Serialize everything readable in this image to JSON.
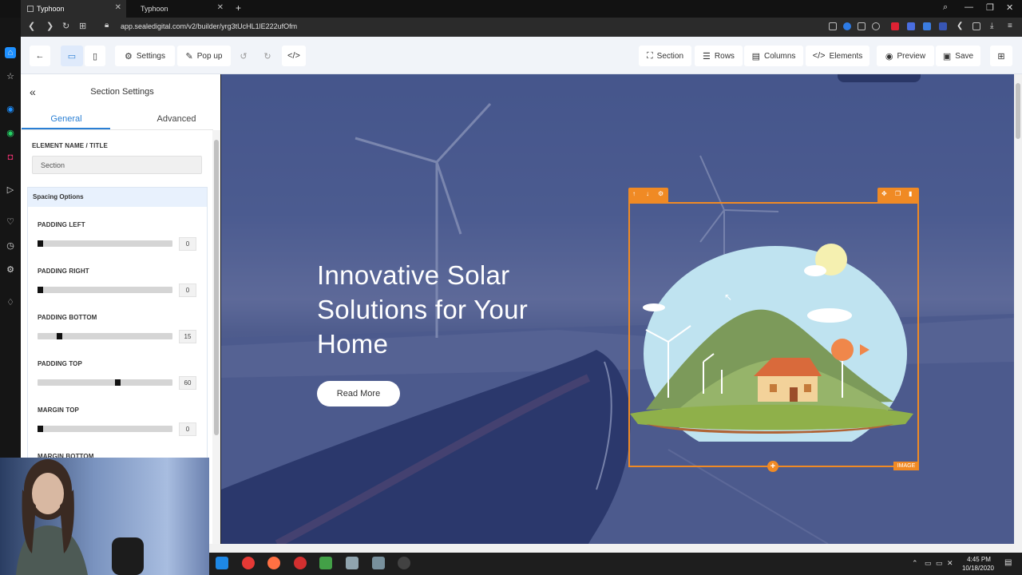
{
  "browser": {
    "tabs": [
      {
        "title": "Typhoon",
        "active": true
      },
      {
        "title": "Typhoon",
        "active": false
      }
    ],
    "new_tab": "+",
    "url": "app.sealedigital.com/v2/builder/yrg3tUcHL1lE222ufOfm"
  },
  "toolbar": {
    "settings": "Settings",
    "popup": "Pop up",
    "section": "Section",
    "rows": "Rows",
    "columns": "Columns",
    "elements": "Elements",
    "preview": "Preview",
    "save": "Save"
  },
  "panel": {
    "title": "Section Settings",
    "tabs": [
      "General",
      "Advanced"
    ],
    "element_name_label": "ELEMENT NAME / TITLE",
    "element_name_value": "Section",
    "spacing_heading": "Spacing Options",
    "sliders": [
      {
        "label": "PADDING LEFT",
        "value": "0",
        "fraction": 0.0
      },
      {
        "label": "PADDING RIGHT",
        "value": "0",
        "fraction": 0.0
      },
      {
        "label": "PADDING BOTTOM",
        "value": "15",
        "fraction": 0.15
      },
      {
        "label": "PADDING TOP",
        "value": "60",
        "fraction": 0.6
      },
      {
        "label": "MARGIN TOP",
        "value": "0",
        "fraction": 0.0
      },
      {
        "label": "MARGIN BOTTOM",
        "value": "",
        "fraction": 0.0
      }
    ]
  },
  "canvas": {
    "headline": "Innovative Solar Solutions for Your Home",
    "button": "Read More",
    "image_tag": "IMAGE",
    "add_symbol": "+"
  },
  "taskbar": {
    "time": "4:45 PM",
    "date": "10/18/2020"
  },
  "colors": {
    "accent": "#2a7fd4",
    "selection": "#f08a24",
    "overlay": "#3c4b86"
  }
}
